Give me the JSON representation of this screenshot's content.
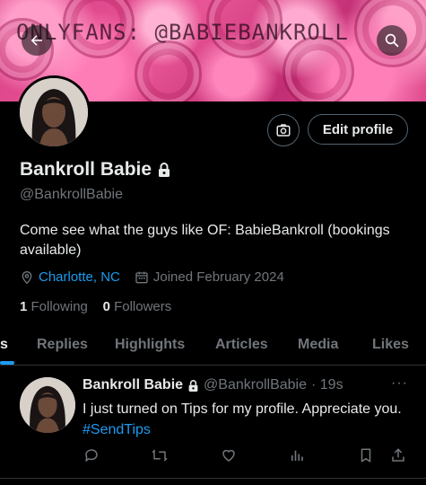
{
  "banner": {
    "text": "ONLYFANS: @BABIEBANKROLL"
  },
  "header": {
    "back_icon": "arrow-left-icon",
    "search_icon": "search-icon"
  },
  "profile": {
    "display_name": "Bankroll Babie",
    "handle": "@BankrollBabie",
    "bio": "Come see what the guys like OF: BabieBankroll (bookings available)",
    "location": "Charlotte, NC",
    "joined": "Joined February 2024",
    "following_count": "1",
    "following_label": "Following",
    "followers_count": "0",
    "followers_label": "Followers",
    "edit_label": "Edit profile"
  },
  "tabs": [
    {
      "label": "s",
      "active": true
    },
    {
      "label": "Replies"
    },
    {
      "label": "Highlights"
    },
    {
      "label": "Articles"
    },
    {
      "label": "Media"
    },
    {
      "label": "Likes"
    }
  ],
  "tweet": {
    "name": "Bankroll Babie",
    "handle": "@BankrollBabie",
    "time": "· 19s",
    "more": "···",
    "text": "I just turned on Tips for my profile. Appreciate you.",
    "hashtag": "#SendTips"
  },
  "colors": {
    "accent": "#1d9bf0",
    "muted": "#71767b",
    "text": "#e7e9ea",
    "background": "#000000"
  }
}
